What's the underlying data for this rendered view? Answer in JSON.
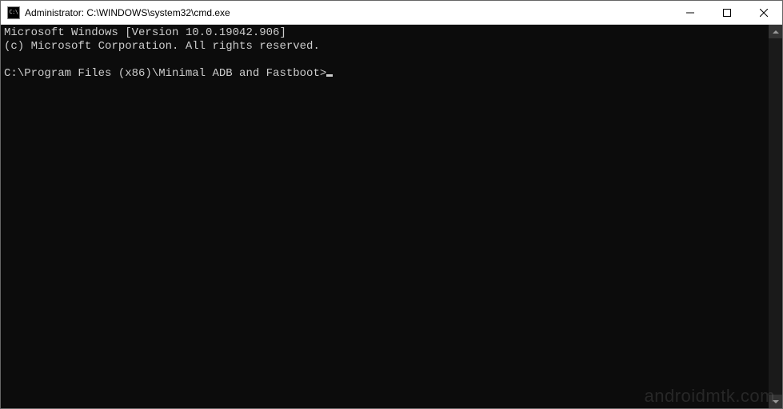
{
  "titlebar": {
    "icon_glyph": "C:\\",
    "title": "Administrator: C:\\WINDOWS\\system32\\cmd.exe"
  },
  "terminal": {
    "lines": [
      "Microsoft Windows [Version 10.0.19042.906]",
      "(c) Microsoft Corporation. All rights reserved.",
      ""
    ],
    "prompt": "C:\\Program Files (x86)\\Minimal ADB and Fastboot>"
  },
  "watermark": "androidmtk.com"
}
